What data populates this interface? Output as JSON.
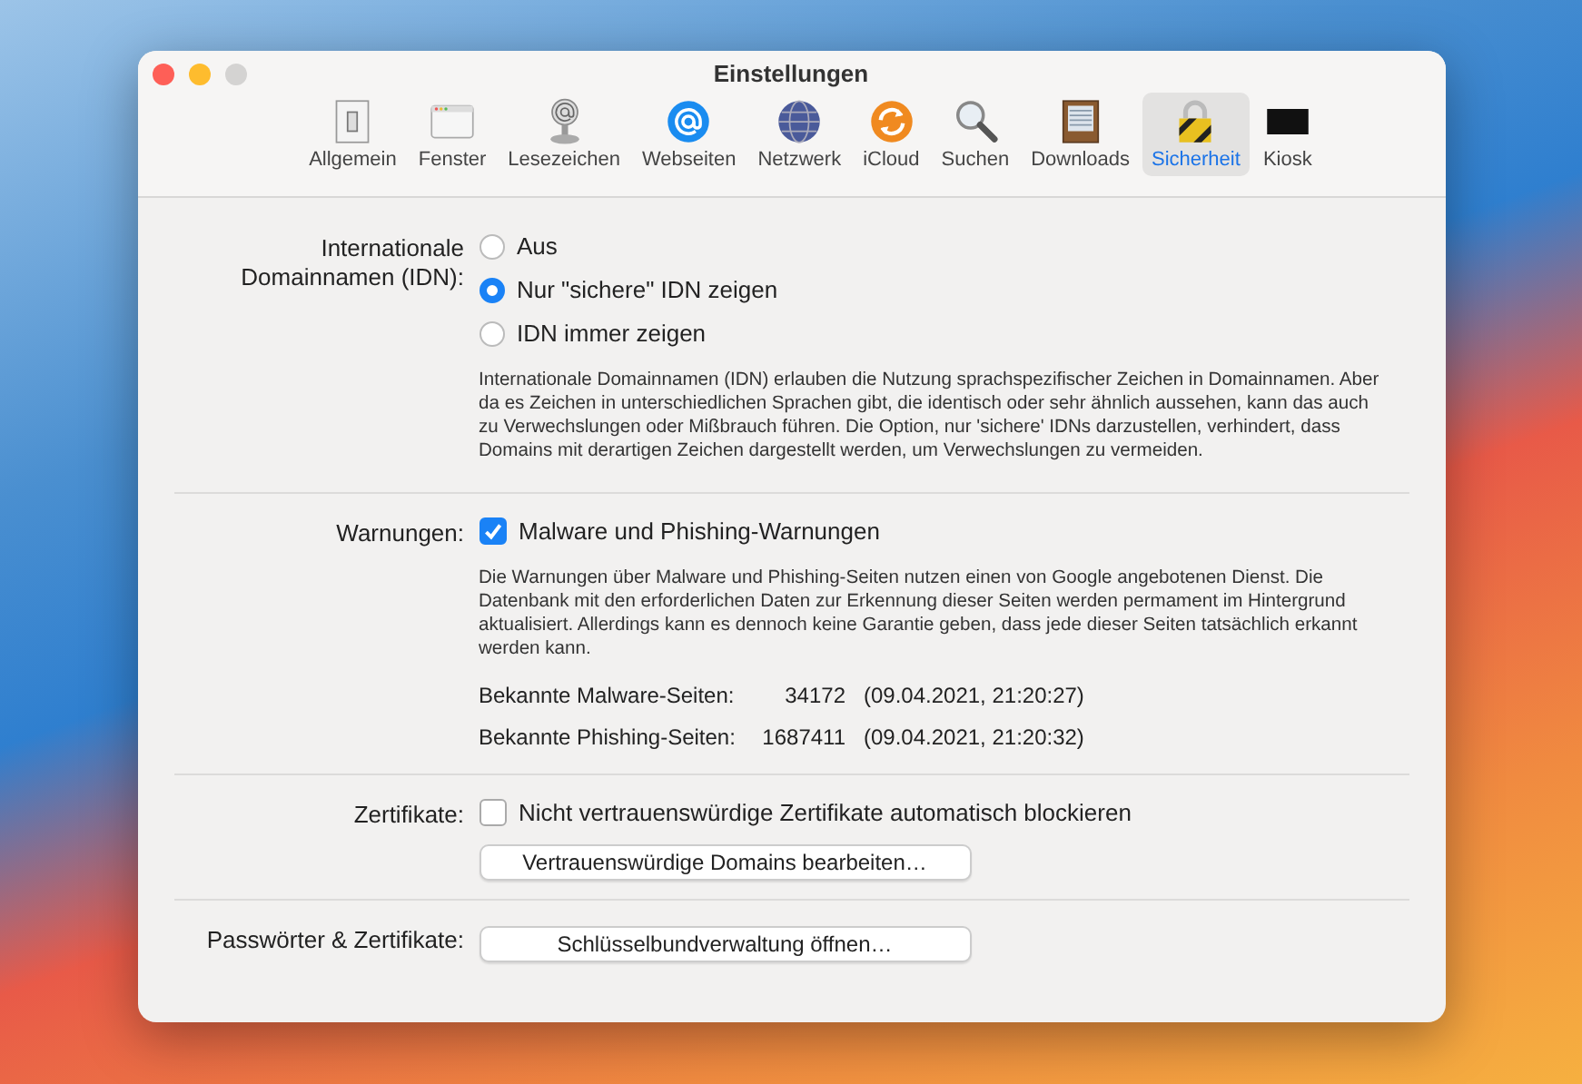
{
  "window": {
    "title": "Einstellungen"
  },
  "tabs": [
    {
      "label": "Allgemein",
      "kind": "switch",
      "selected": false
    },
    {
      "label": "Fenster",
      "kind": "window",
      "selected": false
    },
    {
      "label": "Lesezeichen",
      "kind": "bookmark",
      "selected": false
    },
    {
      "label": "Webseiten",
      "kind": "at",
      "selected": false
    },
    {
      "label": "Netzwerk",
      "kind": "globe",
      "selected": false
    },
    {
      "label": "iCloud",
      "kind": "sync",
      "selected": false
    },
    {
      "label": "Suchen",
      "kind": "magnifier",
      "selected": false
    },
    {
      "label": "Downloads",
      "kind": "drawer",
      "selected": false
    },
    {
      "label": "Sicherheit",
      "kind": "lock",
      "selected": true
    },
    {
      "label": "Kiosk",
      "kind": "screen",
      "selected": false
    }
  ],
  "sections": [
    {
      "label": "Internationale Domainnamen (IDN):",
      "items": [
        {
          "kind": "radio",
          "label": "Aus",
          "selected": false
        },
        {
          "kind": "radio",
          "label": "Nur \"sichere\" IDN zeigen",
          "selected": true
        },
        {
          "kind": "radio",
          "label": "IDN immer zeigen",
          "selected": false
        },
        {
          "kind": "note",
          "text": "Internationale Domainnamen (IDN) erlauben die Nutzung sprachspezifischer Zeichen in Domainnamen. Aber da es Zeichen in unterschiedlichen Sprachen gibt, die identisch oder sehr ähnlich aussehen, kann das auch zu Verwechslungen oder Mißbrauch führen. Die Option, nur 'sichere' IDNs darzustellen, verhindert, dass Domains mit derartigen Zeichen dargestellt werden, um Verwechslungen zu vermeiden."
        }
      ]
    },
    {
      "label": "Warnungen:",
      "items": [
        {
          "kind": "checkbox",
          "label": "Malware und Phishing-Warnungen",
          "checked": true
        },
        {
          "kind": "note",
          "text": "Die Warnungen über Malware und Phishing-Seiten nutzen einen von Google angebotenen Dienst. Die Datenbank mit den erforderlichen Daten zur Erkennung dieser Seiten werden permament im Hintergrund aktualisiert. Allerdings kann es dennoch keine Garantie geben, dass jede dieser Seiten tatsächlich erkannt werden kann."
        },
        {
          "kind": "stat",
          "label": "Bekannte Malware-Seiten:",
          "count": "34172",
          "date": "(09.04.2021, 21:20:27)"
        },
        {
          "kind": "stat",
          "label": "Bekannte Phishing-Seiten:",
          "count": "1687411",
          "date": "(09.04.2021, 21:20:32)"
        }
      ]
    },
    {
      "label": "Zertifikate:",
      "items": [
        {
          "kind": "checkbox",
          "label": "Nicht vertrauenswürdige Zertifikate automatisch blockieren",
          "checked": false
        },
        {
          "kind": "button",
          "label": "Vertrauenswürdige Domains bearbeiten…"
        }
      ]
    },
    {
      "label": "Passwörter & Zertifikate:",
      "items": [
        {
          "kind": "button",
          "label": "Schlüsselbundverwaltung öffnen…"
        }
      ]
    }
  ]
}
